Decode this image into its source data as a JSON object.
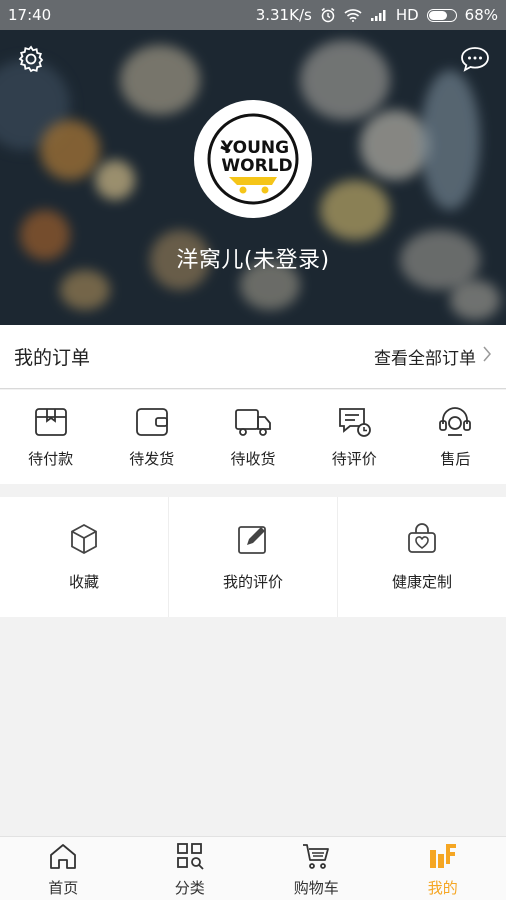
{
  "status_bar": {
    "time": "17:40",
    "network_speed": "3.31K/s",
    "network_type": "HD",
    "battery": "68%",
    "icons": [
      "alarm-icon",
      "wifi-icon",
      "signal-icon",
      "battery-icon"
    ]
  },
  "header": {
    "settings_icon": "gear-icon",
    "message_icon": "chat-bubble-icon",
    "logo_text_line1": "YOUNG",
    "logo_text_line2": "WORLD",
    "username": "洋窝儿(未登录)"
  },
  "orders": {
    "title": "我的订单",
    "view_all": "查看全部订单",
    "statuses": [
      {
        "label": "待付款",
        "icon": "wallet-box-icon"
      },
      {
        "label": "待发货",
        "icon": "wallet-icon"
      },
      {
        "label": "待收货",
        "icon": "truck-icon"
      },
      {
        "label": "待评价",
        "icon": "review-icon"
      },
      {
        "label": "售后",
        "icon": "headset-icon"
      }
    ]
  },
  "features": [
    {
      "label": "收藏",
      "icon": "cube-icon"
    },
    {
      "label": "我的评价",
      "icon": "edit-icon"
    },
    {
      "label": "健康定制",
      "icon": "heart-bag-icon"
    }
  ],
  "tabbar": {
    "active_color": "#f5a623",
    "tabs": [
      {
        "label": "首页",
        "icon": "home-icon"
      },
      {
        "label": "分类",
        "icon": "category-icon"
      },
      {
        "label": "购物车",
        "icon": "cart-icon"
      },
      {
        "label": "我的",
        "icon": "profile-icon",
        "active": true
      }
    ]
  }
}
